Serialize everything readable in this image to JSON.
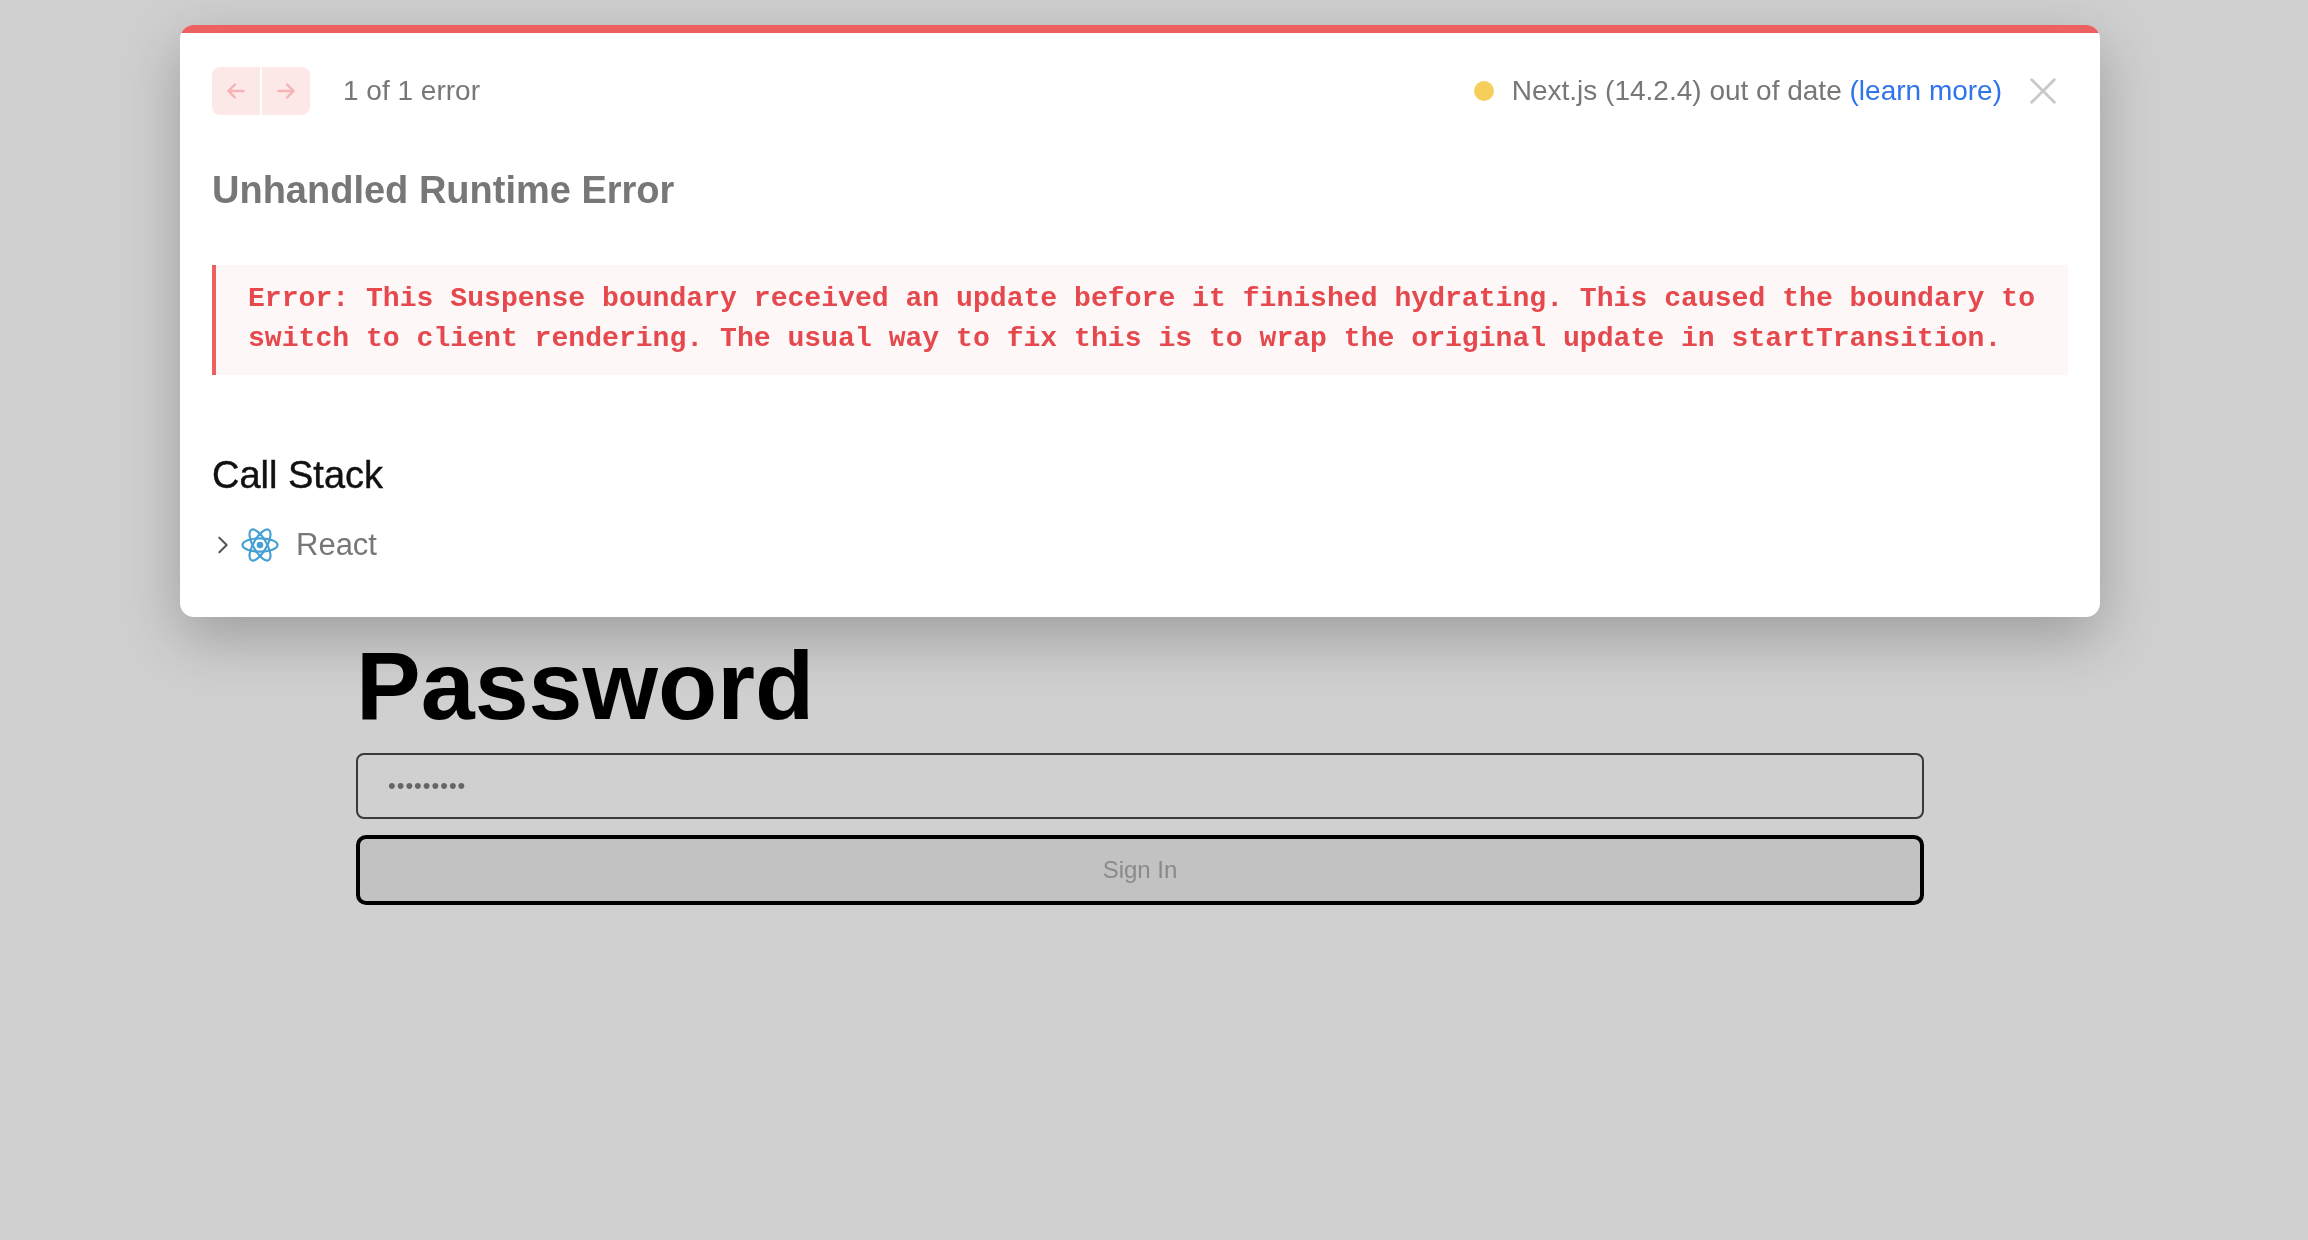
{
  "dialog": {
    "nav_buttons": [
      {
        "kind": "previous",
        "disabled": true
      },
      {
        "kind": "next",
        "disabled": true
      }
    ],
    "error_count": "1 of 1 error",
    "version_notice": {
      "color": "#f5cf5a",
      "text": "Next.js (14.2.4) out of date",
      "link": "(learn more)"
    },
    "title": "Unhandled Runtime Error",
    "error_message": "Error: This Suspense boundary received an update before it finished hydrating. This caused the boundary to switch to client rendering. The usual way to fix this is to wrap the original update in startTransition.",
    "call_stack": {
      "heading": "Call Stack",
      "frames": [
        {
          "label": "React",
          "expanded": false
        }
      ]
    }
  },
  "page": {
    "heading": "Password",
    "password_field": {
      "value": "•••••••••"
    },
    "submit_button": {
      "label": "Sign In",
      "disabled": true
    }
  }
}
